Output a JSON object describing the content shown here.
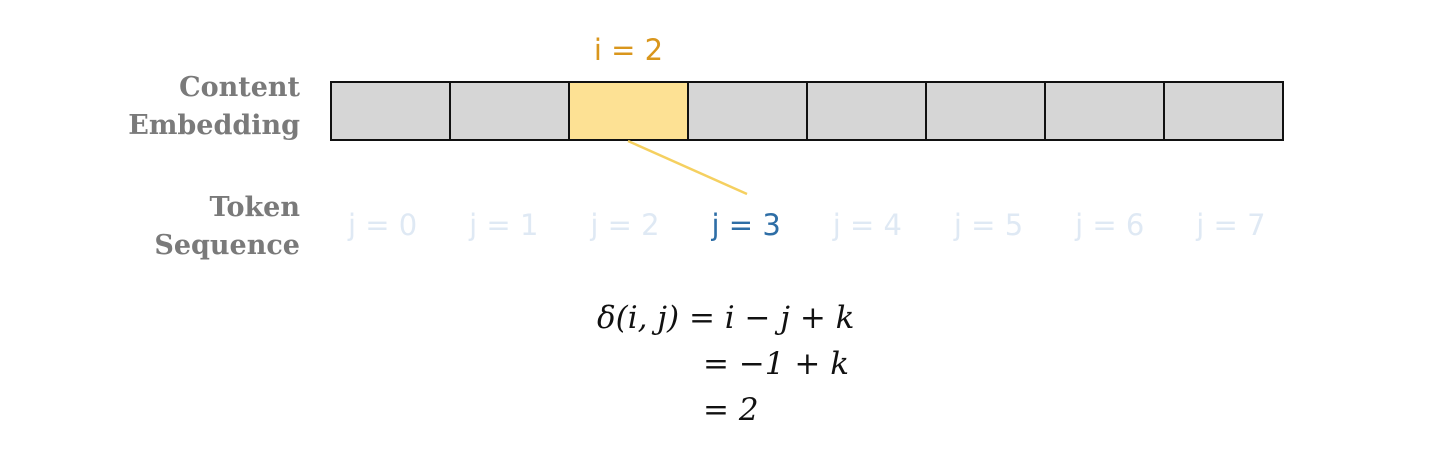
{
  "labels": {
    "content_line1": "Content",
    "content_line2": "Embedding",
    "token_line1": "Token",
    "token_line2": "Sequence"
  },
  "embedding": {
    "cell_count": 8,
    "highlighted_index": 2,
    "highlight_label": "i = 2",
    "cell_color": "#d6d6d6",
    "highlight_color": "#fde194"
  },
  "tokens": [
    "j = 0",
    "j = 1",
    "j = 2",
    "j = 3",
    "j = 4",
    "j = 5",
    "j = 6",
    "j = 7"
  ],
  "active_token_index": 3,
  "colors": {
    "i_label": "#d9961c",
    "active_token": "#2e6ea6",
    "inactive_token": "#dfe9f4",
    "connector": "#f5d060",
    "row_label": "#7a7a7a"
  },
  "equation": {
    "line1": "δ(i, j) = i − j + k",
    "line2": "= −1 + k",
    "line3": "= 2"
  }
}
